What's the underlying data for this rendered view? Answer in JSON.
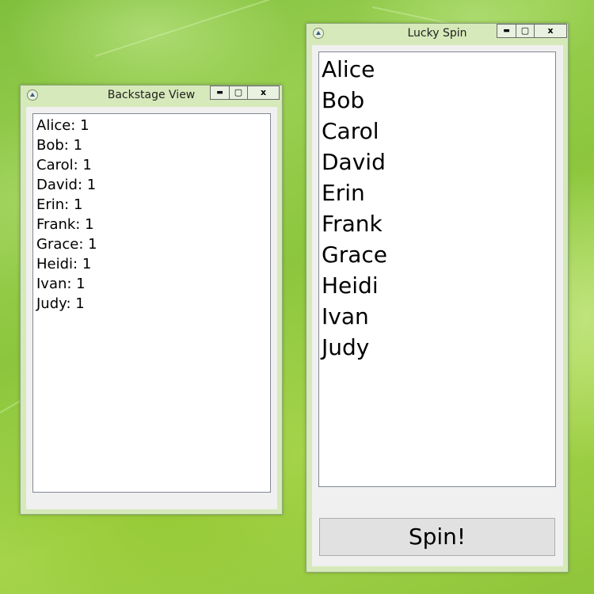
{
  "backstage_window": {
    "title": "Backstage View",
    "entries": [
      "Alice: 1",
      "Bob: 1",
      "Carol: 1",
      "David: 1",
      "Erin: 1",
      "Frank: 1",
      "Grace: 1",
      "Heidi: 1",
      "Ivan: 1",
      "Judy: 1"
    ]
  },
  "spin_window": {
    "title": "Lucky Spin",
    "names": [
      "Alice",
      "Bob",
      "Carol",
      "David",
      "Erin",
      "Frank",
      "Grace",
      "Heidi",
      "Ivan",
      "Judy"
    ],
    "spin_label": "Spin!"
  },
  "caption_buttons": {
    "minimize": "▬",
    "maximize": "▢",
    "close": "x"
  },
  "icons": {
    "window_icon": "app-icon"
  }
}
